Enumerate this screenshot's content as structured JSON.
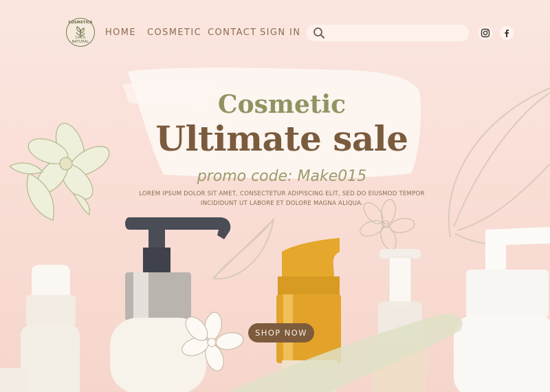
{
  "logo": {
    "top_text": "COSMETICS",
    "bottom_text": "100% NATURAL"
  },
  "nav": {
    "items": [
      "HOME",
      "COSMETIC",
      "CONTACT",
      "SIGN IN"
    ]
  },
  "search": {
    "placeholder": "",
    "icon": "search-icon"
  },
  "social": [
    "instagram-icon",
    "facebook-icon"
  ],
  "hero": {
    "subtitle": "Cosmetic",
    "title": "Ultimate sale",
    "promo": "promo code: Make015",
    "body": "LOREM IPSUM DOLOR SIT AMET, CONSECTETUR ADIPISCING ELIT, SED DO EIUSMOD TEMPOR INCIDIDUNT UT LABORE ET DOLORE MAGNA ALIQUA.",
    "cta": "SHOP NOW"
  },
  "colors": {
    "background": "#f9ddd5",
    "brand_brown": "#7a5b3d",
    "olive": "#8f9462",
    "cta": "#7d5b3d"
  }
}
